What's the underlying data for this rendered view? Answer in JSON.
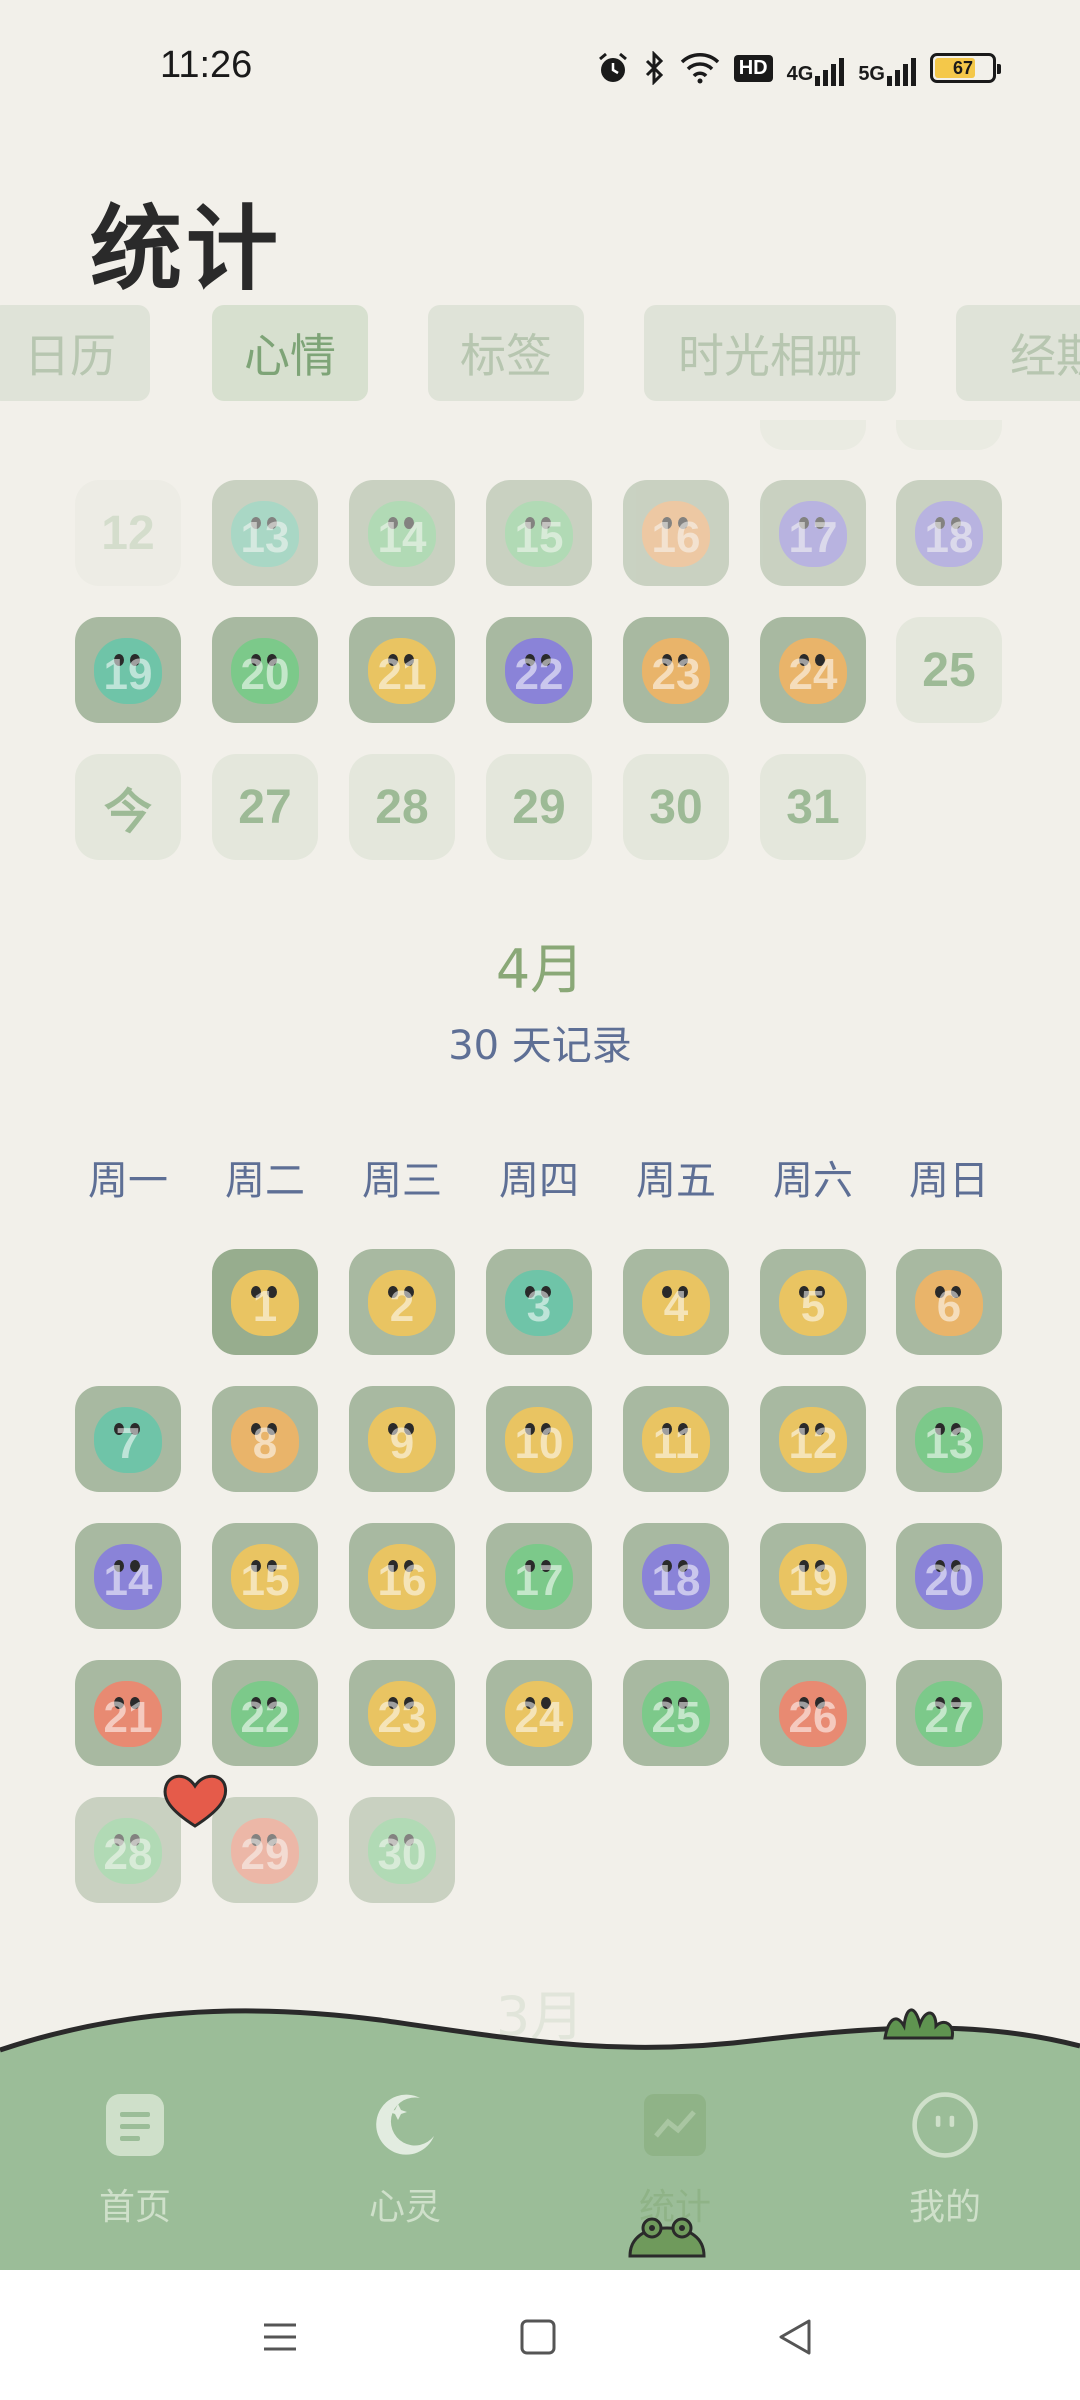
{
  "status_bar": {
    "time": "11:26",
    "battery": "67",
    "net1": "4G",
    "net2": "5G",
    "hd": "HD"
  },
  "header": {
    "title": "统计"
  },
  "tabs": [
    {
      "label": "日历",
      "active": false
    },
    {
      "label": "心情",
      "active": true
    },
    {
      "label": "标签",
      "active": false
    },
    {
      "label": "时光相册",
      "active": false
    },
    {
      "label": "经期",
      "active": false
    }
  ],
  "march_partial": {
    "row1": [
      "12",
      "13",
      "14",
      "15",
      "16",
      "17",
      "18"
    ],
    "row2": [
      "19",
      "20",
      "21",
      "22",
      "23",
      "24",
      "25"
    ],
    "row3": [
      "今",
      "27",
      "28",
      "29",
      "30",
      "31"
    ]
  },
  "april": {
    "month": "4月",
    "count_text": "30 天记录",
    "weekdays": [
      "周一",
      "周二",
      "周三",
      "周四",
      "周五",
      "周六",
      "周日"
    ],
    "days": [
      "1",
      "2",
      "3",
      "4",
      "5",
      "6",
      "7",
      "8",
      "9",
      "10",
      "11",
      "12",
      "13",
      "14",
      "15",
      "16",
      "17",
      "18",
      "19",
      "20",
      "21",
      "22",
      "23",
      "24",
      "25",
      "26",
      "27",
      "28",
      "29",
      "30"
    ]
  },
  "next_month": {
    "month": "3月"
  },
  "bottom_nav": [
    {
      "label": "首页",
      "icon": "home-robot-icon"
    },
    {
      "label": "心灵",
      "icon": "moon-icon"
    },
    {
      "label": "统计",
      "icon": "chart-icon",
      "active": true
    },
    {
      "label": "我的",
      "icon": "smiley-icon"
    }
  ],
  "mood_colors": {
    "yellow": "#e9c462",
    "green": "#7cc98a",
    "purple": "#8a83d8",
    "red": "#e88a72",
    "teal": "#6fc4a8"
  }
}
